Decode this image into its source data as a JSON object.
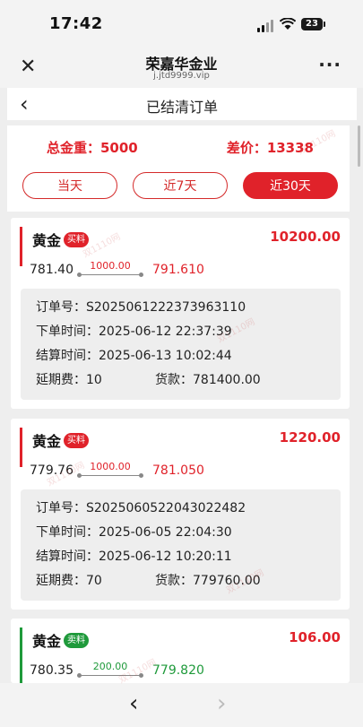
{
  "status": {
    "time": "17:42",
    "battery": "23"
  },
  "browser": {
    "title": "荣嘉华金业",
    "url": "j.jtd9999.vip"
  },
  "page": {
    "title": "已结清订单"
  },
  "summary": {
    "total_weight": "总金重：5000",
    "price_diff": "差价：13338"
  },
  "filters": [
    {
      "label": "当天"
    },
    {
      "label": "近7天"
    },
    {
      "label": "近30天"
    }
  ],
  "orders": [
    {
      "metal": "黄金",
      "tag": "买料",
      "pnl": "10200.00",
      "open_price": "781.40",
      "diff": "1000.00",
      "close_price": "791.610",
      "order_no": "订单号：S2025061222373963110",
      "order_time": "下单时间：2025-06-12 22:37:39",
      "settle_time": "结算时间：2025-06-13 10:02:44",
      "deferral": "延期费：10",
      "payment": "货款：781400.00",
      "color": "#e0222a"
    },
    {
      "metal": "黄金",
      "tag": "买料",
      "pnl": "1220.00",
      "open_price": "779.76",
      "diff": "1000.00",
      "close_price": "781.050",
      "order_no": "订单号：S2025060522043022482",
      "order_time": "下单时间：2025-06-05 22:04:30",
      "settle_time": "结算时间：2025-06-12 10:20:11",
      "deferral": "延期费：70",
      "payment": "货款：779760.00",
      "color": "#e0222a"
    },
    {
      "metal": "黄金",
      "tag": "卖料",
      "pnl": "106.00",
      "open_price": "780.35",
      "diff": "200.00",
      "close_price": "779.820",
      "color": "#1f9a3b"
    }
  ],
  "nav": {
    "back": "‹",
    "forward": "›"
  },
  "watermark": "双1110网"
}
